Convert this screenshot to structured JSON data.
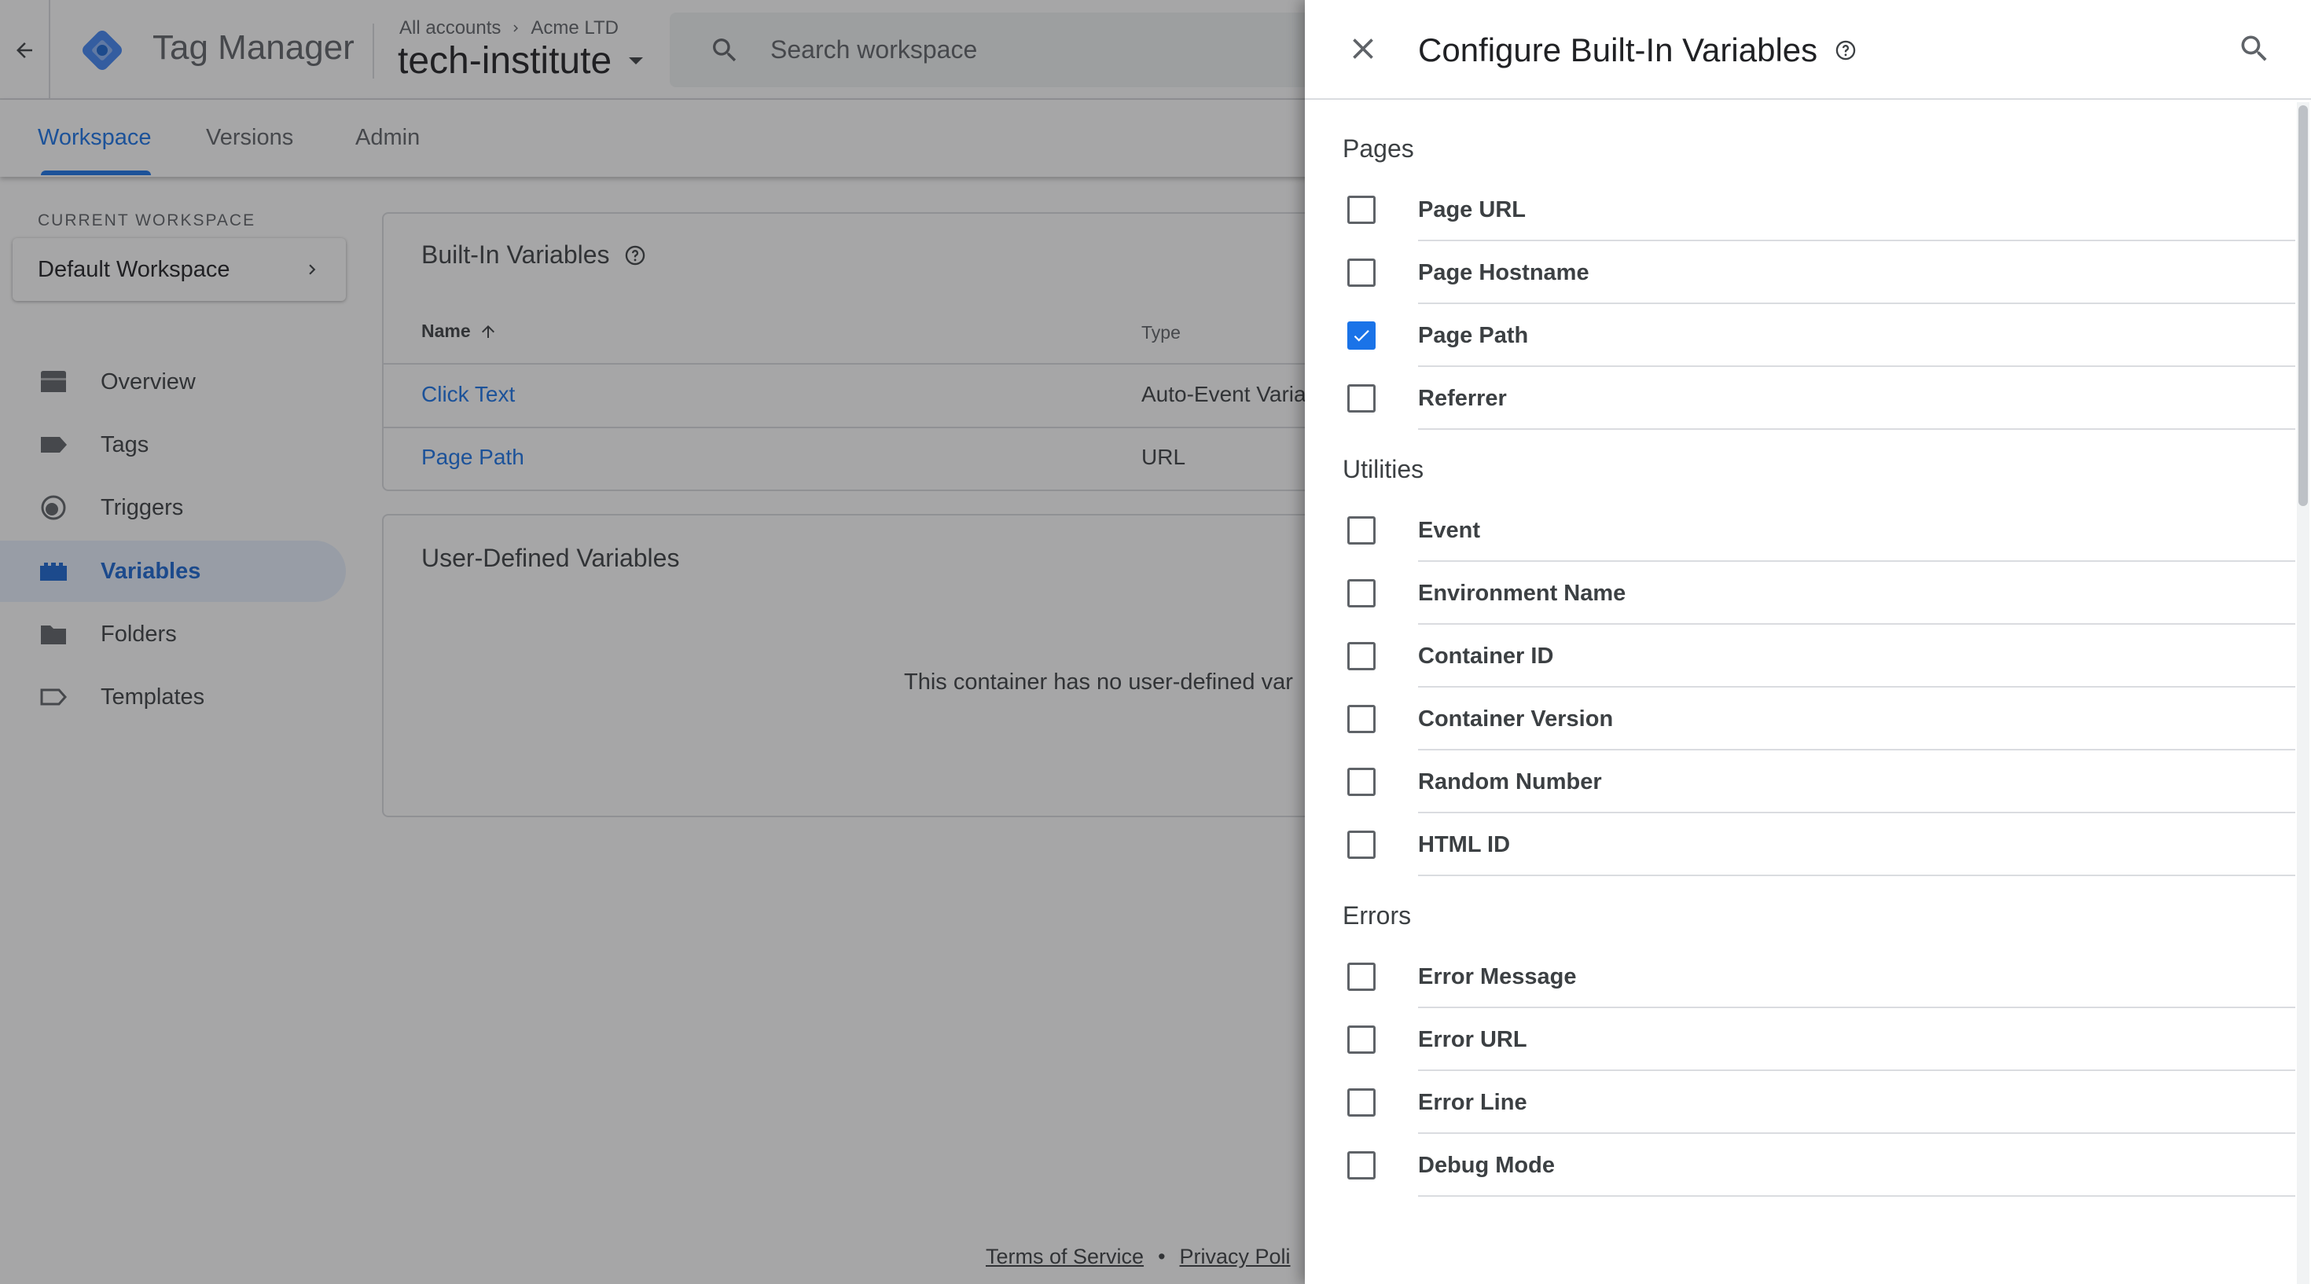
{
  "header": {
    "app_name": "Tag Manager",
    "breadcrumb": {
      "account_link": "All accounts",
      "account_name": "Acme LTD"
    },
    "container_name": "tech-institute",
    "search_placeholder": "Search workspace"
  },
  "tabs": [
    {
      "label": "Workspace",
      "active": true
    },
    {
      "label": "Versions",
      "active": false
    },
    {
      "label": "Admin",
      "active": false
    }
  ],
  "sidebar": {
    "current_workspace_label": "CURRENT WORKSPACE",
    "workspace_name": "Default Workspace",
    "nav": [
      {
        "label": "Overview",
        "icon": "overview-icon"
      },
      {
        "label": "Tags",
        "icon": "tag-icon"
      },
      {
        "label": "Triggers",
        "icon": "trigger-icon"
      },
      {
        "label": "Variables",
        "icon": "variables-icon",
        "active": true
      },
      {
        "label": "Folders",
        "icon": "folder-icon"
      },
      {
        "label": "Templates",
        "icon": "template-icon"
      }
    ]
  },
  "builtin_card": {
    "title": "Built-In Variables",
    "columns": {
      "name": "Name",
      "type": "Type"
    },
    "rows": [
      {
        "name": "Click Text",
        "type": "Auto-Event Varia"
      },
      {
        "name": "Page Path",
        "type": "URL"
      }
    ]
  },
  "user_card": {
    "title": "User-Defined Variables",
    "empty_message": "This container has no user-defined var"
  },
  "footer": {
    "terms": "Terms of Service",
    "separator": "•",
    "privacy": "Privacy Poli"
  },
  "drawer": {
    "title": "Configure Built-In Variables",
    "sections": [
      {
        "title": "Pages",
        "options": [
          {
            "label": "Page URL",
            "checked": false
          },
          {
            "label": "Page Hostname",
            "checked": false
          },
          {
            "label": "Page Path",
            "checked": true
          },
          {
            "label": "Referrer",
            "checked": false
          }
        ]
      },
      {
        "title": "Utilities",
        "options": [
          {
            "label": "Event",
            "checked": false
          },
          {
            "label": "Environment Name",
            "checked": false
          },
          {
            "label": "Container ID",
            "checked": false
          },
          {
            "label": "Container Version",
            "checked": false
          },
          {
            "label": "Random Number",
            "checked": false
          },
          {
            "label": "HTML ID",
            "checked": false
          }
        ]
      },
      {
        "title": "Errors",
        "options": [
          {
            "label": "Error Message",
            "checked": false
          },
          {
            "label": "Error URL",
            "checked": false
          },
          {
            "label": "Error Line",
            "checked": false
          },
          {
            "label": "Debug Mode",
            "checked": false
          }
        ]
      }
    ]
  },
  "colors": {
    "accent": "#1a73e8",
    "active_nav_bg": "#e8f0fe",
    "text": "#3c4043",
    "muted": "#5f6368",
    "divider": "#dadce0"
  }
}
